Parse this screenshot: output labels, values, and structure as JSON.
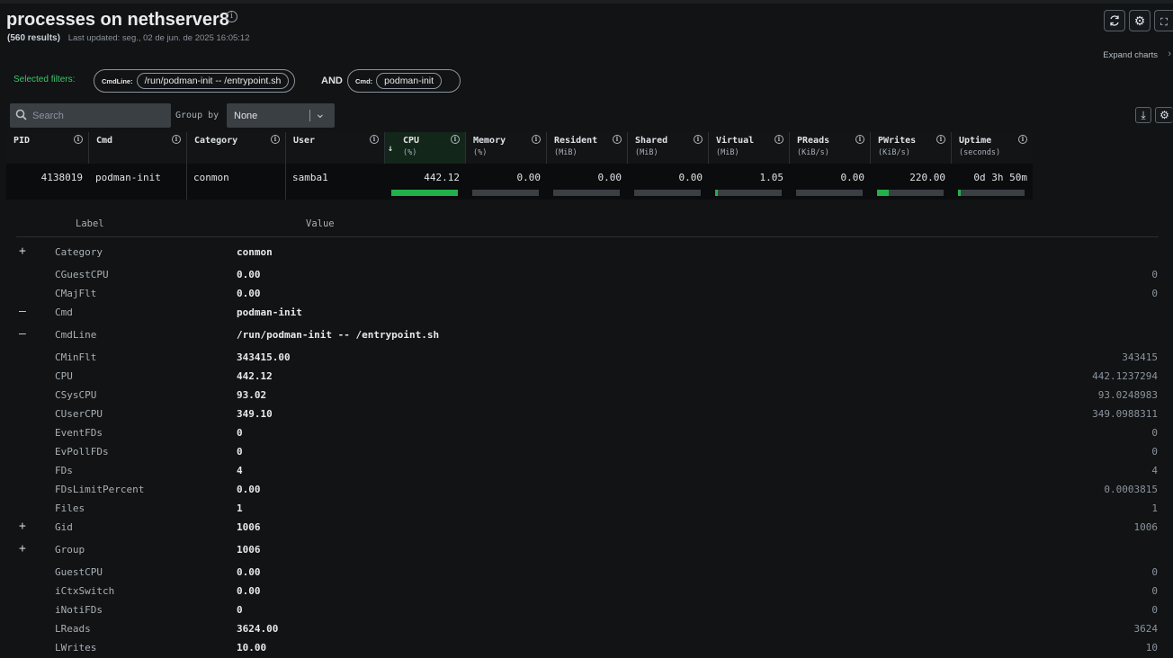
{
  "header": {
    "title": "processes on nethserver8",
    "results": "(560 results)",
    "last_updated": "Last updated: seg., 02 de jun. de 2025 16:05:12",
    "expand_charts": "Expand charts"
  },
  "filters": {
    "label": "Selected filters:",
    "chip1_key": "CmdLine:",
    "chip1_value": "/run/podman-init -- /entrypoint.sh",
    "and": "AND",
    "chip2_key": "Cmd:",
    "chip2_value": "podman-init"
  },
  "toolbar": {
    "search_placeholder": "Search",
    "group_by_label": "Group by",
    "group_by_value": "None"
  },
  "columns": {
    "pid": "PID",
    "cmd": "Cmd",
    "category": "Category",
    "user": "User",
    "cpu": "CPU",
    "cpu_unit": "(%)",
    "memory": "Memory",
    "memory_unit": "(%)",
    "resident": "Resident",
    "resident_unit": "(MiB)",
    "shared": "Shared",
    "shared_unit": "(MiB)",
    "virtual": "Virtual",
    "virtual_unit": "(MiB)",
    "preads": "PReads",
    "preads_unit": "(KiB/s)",
    "pwrites": "PWrites",
    "pwrites_unit": "(KiB/s)",
    "uptime": "Uptime",
    "uptime_unit": "(seconds)"
  },
  "row": {
    "pid": "4138019",
    "cmd": "podman-init",
    "category": "conmon",
    "user": "samba1",
    "cpu": "442.12",
    "memory": "0.00",
    "resident": "0.00",
    "shared": "0.00",
    "virtual": "1.05",
    "preads": "0.00",
    "pwrites": "220.00",
    "uptime": "0d 3h 50m",
    "bars": {
      "cpu": 1.0,
      "memory": 0,
      "resident": 0,
      "shared": 0,
      "virtual": 0.02,
      "preads": 0,
      "pwrites": 0.18,
      "uptime": 0.02
    }
  },
  "details": {
    "label_header": "Label",
    "value_header": "Value",
    "rows": [
      {
        "toggle": "+",
        "label": "Category",
        "value": "conmon",
        "raw": ""
      },
      {
        "toggle": "",
        "label": "CGuestCPU",
        "value": "0.00",
        "raw": "0"
      },
      {
        "toggle": "",
        "label": "CMajFlt",
        "value": "0.00",
        "raw": "0"
      },
      {
        "toggle": "—",
        "label": "Cmd",
        "value": "podman-init",
        "raw": ""
      },
      {
        "toggle": "—",
        "label": "CmdLine",
        "value": "/run/podman-init -- /entrypoint.sh",
        "raw": ""
      },
      {
        "toggle": "",
        "label": "CMinFlt",
        "value": "343415.00",
        "raw": "343415"
      },
      {
        "toggle": "",
        "label": "CPU",
        "value": "442.12",
        "raw": "442.1237294"
      },
      {
        "toggle": "",
        "label": "CSysCPU",
        "value": "93.02",
        "raw": "93.0248983"
      },
      {
        "toggle": "",
        "label": "CUserCPU",
        "value": "349.10",
        "raw": "349.0988311"
      },
      {
        "toggle": "",
        "label": "EventFDs",
        "value": "0",
        "raw": "0"
      },
      {
        "toggle": "",
        "label": "EvPollFDs",
        "value": "0",
        "raw": "0"
      },
      {
        "toggle": "",
        "label": "FDs",
        "value": "4",
        "raw": "4"
      },
      {
        "toggle": "",
        "label": "FDsLimitPercent",
        "value": "0.00",
        "raw": "0.0003815"
      },
      {
        "toggle": "",
        "label": "Files",
        "value": "1",
        "raw": "1"
      },
      {
        "toggle": "+",
        "label": "Gid",
        "value": "1006",
        "raw": "1006"
      },
      {
        "toggle": "+",
        "label": "Group",
        "value": "1006",
        "raw": ""
      },
      {
        "toggle": "",
        "label": "GuestCPU",
        "value": "0.00",
        "raw": "0"
      },
      {
        "toggle": "",
        "label": "iCtxSwitch",
        "value": "0.00",
        "raw": "0"
      },
      {
        "toggle": "",
        "label": "iNotiFDs",
        "value": "0",
        "raw": "0"
      },
      {
        "toggle": "",
        "label": "LReads",
        "value": "3624.00",
        "raw": "3624"
      },
      {
        "toggle": "",
        "label": "LWrites",
        "value": "10.00",
        "raw": "10"
      }
    ]
  }
}
